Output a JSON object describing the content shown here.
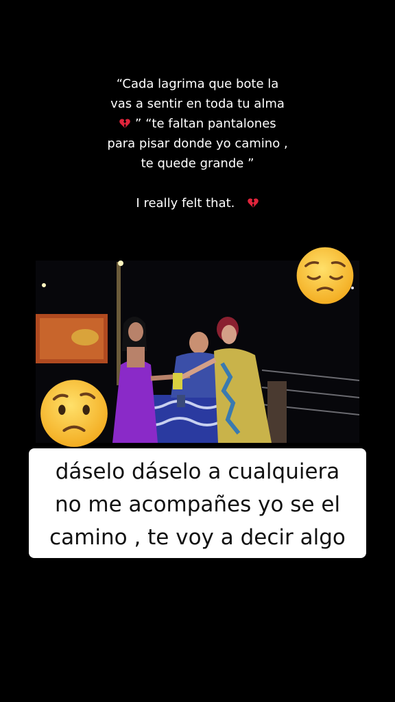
{
  "caption": {
    "line1": "“Cada lagrima que bote la",
    "line2": "vas a sentir en toda tu alma",
    "line3_quote": " ” “te faltan pantalones",
    "line4": "para pisar donde yo camino ,",
    "line5": "te quede grande ”",
    "line6": "I really felt that."
  },
  "icons": {
    "broken_heart": "broken-heart-emoji",
    "pensive_face": "pensive-face-emoji",
    "worried_face": "worried-face-emoji"
  },
  "subtitle": {
    "line1": "dáselo dáselo a cualquiera",
    "line2": "no me acompañes yo se el",
    "line3": "camino , te voy a decir algo"
  },
  "colors": {
    "background": "#000000",
    "subtitle_bg": "#ffffff",
    "heart": "#e0243b",
    "emoji_yellow": "#f7c23c"
  }
}
